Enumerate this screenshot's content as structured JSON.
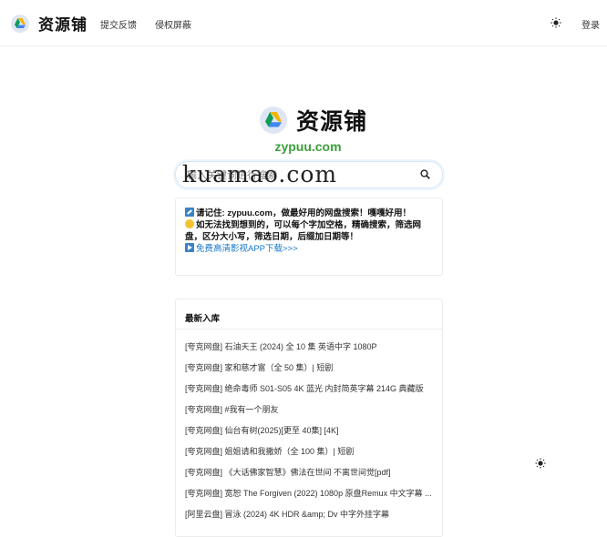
{
  "header": {
    "brand": "资源铺",
    "nav": [
      "提交反馈",
      "侵权屏蔽"
    ],
    "login": "登录"
  },
  "hero": {
    "title": "资源铺",
    "domain": "zypuu.com"
  },
  "search": {
    "placeholder": "输入关键词进行搜索"
  },
  "watermark": "kuamao.com",
  "notice": {
    "line1_prefix": "请记住: ",
    "line1_domain": "zypuu.com",
    "line1_suffix": "，做最好用的网盘搜索！嘎嘎好用！",
    "line2": "如无法找到想到的，可以每个字加空格，精确搜索，筛选网盘，区分大小写，筛选日期，后缀加日期等！",
    "line3": "免费高清影视APP下载>>>"
  },
  "latest": {
    "heading": "最新入库",
    "items": [
      "[夸克网盘] 石油天王 (2024) 全 10 集 英语中字 1080P",
      "[夸克网盘] 家和慈才富（全 50 集）| 短剧",
      "[夸克网盘] 绝命毒师 S01-S05 4K 蓝光 内封简英字幕 214G 典藏版",
      "[夸克网盘] #我有一个朋友",
      "[夸克网盘] 仙台有树(2025)[更至 40集] [4K]",
      "[夸克网盘] 姐姐请和我撒娇（全 100 集）| 短剧",
      "[夸克网盘] 《大话佛家智慧》佛法在世间 不离世间觉[pdf]",
      "[夸克网盘] 宽恕 The Forgiven (2022) 1080p 原盘Remux 中文字幕 ...",
      "[阿里云盘] 冒泳 (2024) 4K HDR &amp; Dv 中字外挂字幕"
    ]
  },
  "colors": {
    "accent_blue": "#1677c9",
    "domain_green": "#3a9f3a"
  },
  "icons": {
    "theme": "sun-icon",
    "search": "search-icon",
    "logo": "drive-logo-icon"
  }
}
